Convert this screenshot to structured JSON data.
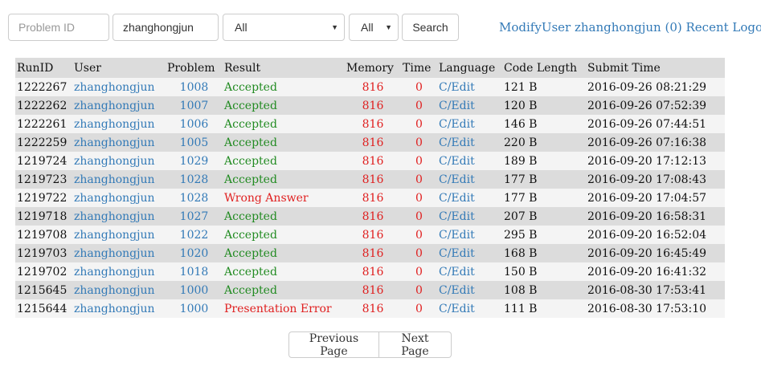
{
  "filters": {
    "problem_id_placeholder": "Problem ID",
    "user_value": "zhanghongjun",
    "result_selected": "All",
    "language_selected": "All",
    "search_label": "Search"
  },
  "nav": {
    "modify_label": "ModifyUser",
    "username": "zhanghongjun",
    "message_count": "(0)",
    "recent_label": "Recent",
    "logout_label": "Logout"
  },
  "table": {
    "headers": [
      "RunID",
      "User",
      "Problem",
      "Result",
      "Memory",
      "Time",
      "Language",
      "Code Length",
      "Submit Time"
    ],
    "rows": [
      {
        "run_id": "1222267",
        "user": "zhanghongjun",
        "problem": "1008",
        "result": "Accepted",
        "memory": "816",
        "time": "0",
        "language": "C/Edit",
        "code_length": "121 B",
        "submit_time": "2016-09-26 08:21:29"
      },
      {
        "run_id": "1222262",
        "user": "zhanghongjun",
        "problem": "1007",
        "result": "Accepted",
        "memory": "816",
        "time": "0",
        "language": "C/Edit",
        "code_length": "120 B",
        "submit_time": "2016-09-26 07:52:39"
      },
      {
        "run_id": "1222261",
        "user": "zhanghongjun",
        "problem": "1006",
        "result": "Accepted",
        "memory": "816",
        "time": "0",
        "language": "C/Edit",
        "code_length": "146 B",
        "submit_time": "2016-09-26 07:44:51"
      },
      {
        "run_id": "1222259",
        "user": "zhanghongjun",
        "problem": "1005",
        "result": "Accepted",
        "memory": "816",
        "time": "0",
        "language": "C/Edit",
        "code_length": "220 B",
        "submit_time": "2016-09-26 07:16:38"
      },
      {
        "run_id": "1219724",
        "user": "zhanghongjun",
        "problem": "1029",
        "result": "Accepted",
        "memory": "816",
        "time": "0",
        "language": "C/Edit",
        "code_length": "189 B",
        "submit_time": "2016-09-20 17:12:13"
      },
      {
        "run_id": "1219723",
        "user": "zhanghongjun",
        "problem": "1028",
        "result": "Accepted",
        "memory": "816",
        "time": "0",
        "language": "C/Edit",
        "code_length": "177 B",
        "submit_time": "2016-09-20 17:08:43"
      },
      {
        "run_id": "1219722",
        "user": "zhanghongjun",
        "problem": "1028",
        "result": "Wrong Answer",
        "memory": "816",
        "time": "0",
        "language": "C/Edit",
        "code_length": "177 B",
        "submit_time": "2016-09-20 17:04:57"
      },
      {
        "run_id": "1219718",
        "user": "zhanghongjun",
        "problem": "1027",
        "result": "Accepted",
        "memory": "816",
        "time": "0",
        "language": "C/Edit",
        "code_length": "207 B",
        "submit_time": "2016-09-20 16:58:31"
      },
      {
        "run_id": "1219708",
        "user": "zhanghongjun",
        "problem": "1022",
        "result": "Accepted",
        "memory": "816",
        "time": "0",
        "language": "C/Edit",
        "code_length": "295 B",
        "submit_time": "2016-09-20 16:52:04"
      },
      {
        "run_id": "1219703",
        "user": "zhanghongjun",
        "problem": "1020",
        "result": "Accepted",
        "memory": "816",
        "time": "0",
        "language": "C/Edit",
        "code_length": "168 B",
        "submit_time": "2016-09-20 16:45:49"
      },
      {
        "run_id": "1219702",
        "user": "zhanghongjun",
        "problem": "1018",
        "result": "Accepted",
        "memory": "816",
        "time": "0",
        "language": "C/Edit",
        "code_length": "150 B",
        "submit_time": "2016-09-20 16:41:32"
      },
      {
        "run_id": "1215645",
        "user": "zhanghongjun",
        "problem": "1000",
        "result": "Accepted",
        "memory": "816",
        "time": "0",
        "language": "C/Edit",
        "code_length": "108 B",
        "submit_time": "2016-08-30 17:53:41"
      },
      {
        "run_id": "1215644",
        "user": "zhanghongjun",
        "problem": "1000",
        "result": "Presentation Error",
        "memory": "816",
        "time": "0",
        "language": "C/Edit",
        "code_length": "111 B",
        "submit_time": "2016-08-30 17:53:10"
      }
    ]
  },
  "pagination": {
    "previous_label": "Previous Page",
    "next_label": "Next Page"
  },
  "colors": {
    "link": "#337ab7",
    "accepted": "#228b22",
    "error": "#e02020",
    "row_light": "#f4f4f4",
    "row_dark": "#dcdcdc"
  }
}
